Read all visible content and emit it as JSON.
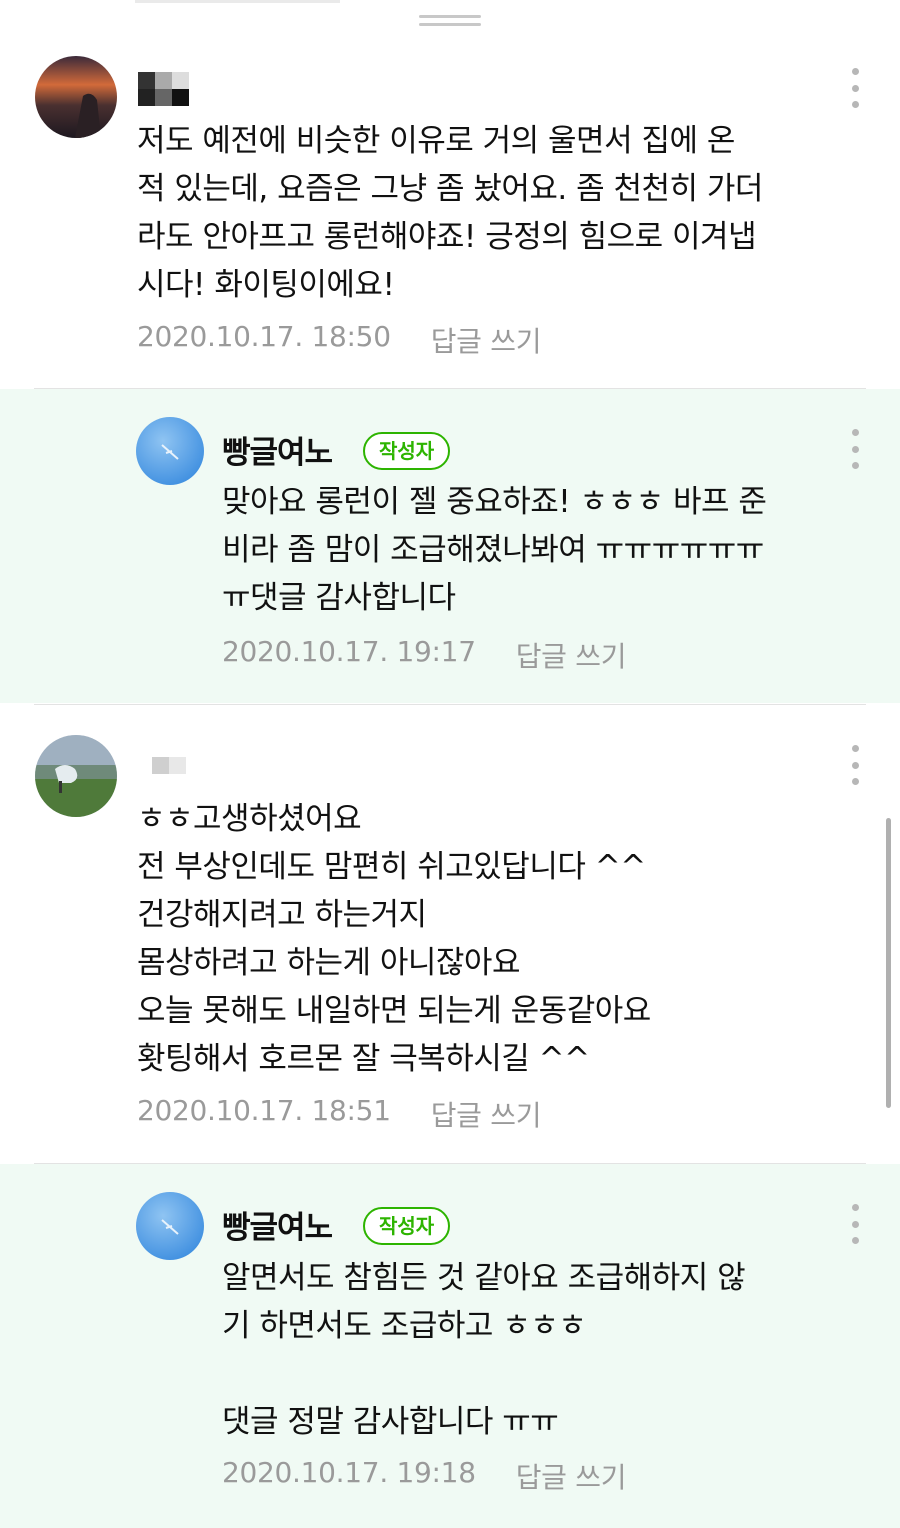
{
  "comments": [
    {
      "type": "comment",
      "text": "저도 예전에 비슷한 이유로 거의 울면서 집에 온\n적 있는데, 요즘은 그냥 좀 놨어요. 좀 천천히 가더\n라도 안아프고 롱런해야죠! 긍정의 힘으로 이겨냅\n시다! 화이팅이에요!",
      "date": "2020.10.17. 18:50",
      "reply_label": "답글 쓰기"
    },
    {
      "type": "reply",
      "author": "빵글여노",
      "badge": "작성자",
      "text": "맞아요 롱런이 젤 중요하죠! ㅎㅎㅎ 바프 준\n비라 좀 맘이 조급해졌나봐여 ㅠㅠㅠㅠㅠㅠ\nㅠ댓글 감사합니다",
      "date": "2020.10.17. 19:17",
      "reply_label": "답글 쓰기"
    },
    {
      "type": "comment",
      "text": "ㅎㅎ고생하셨어요\n전 부상인데도 맘편히 쉬고있답니다 ^^\n건강해지려고 하는거지\n몸상하려고 하는게 아니잖아요\n오늘 못해도 내일하면 되는게 운동같아요\n홧팅해서 호르몬 잘 극복하시길 ^^",
      "date": "2020.10.17. 18:51",
      "reply_label": "답글 쓰기"
    },
    {
      "type": "reply",
      "author": "빵글여노",
      "badge": "작성자",
      "text": "알면서도 참힘든 것 같아요 조급해하지 않\n기 하면서도 조급하고 ㅎㅎㅎ\n\n댓글 정말 감사합니다 ㅠㅠ",
      "date": "2020.10.17. 19:18",
      "reply_label": "답글 쓰기"
    }
  ],
  "colors": {
    "badge_green": "#2db400",
    "reply_bg": "#f0faf4",
    "meta_gray": "#9a9a9a"
  },
  "icons": {
    "more": "more-vertical-icon",
    "handle": "drag-handle-icon"
  }
}
